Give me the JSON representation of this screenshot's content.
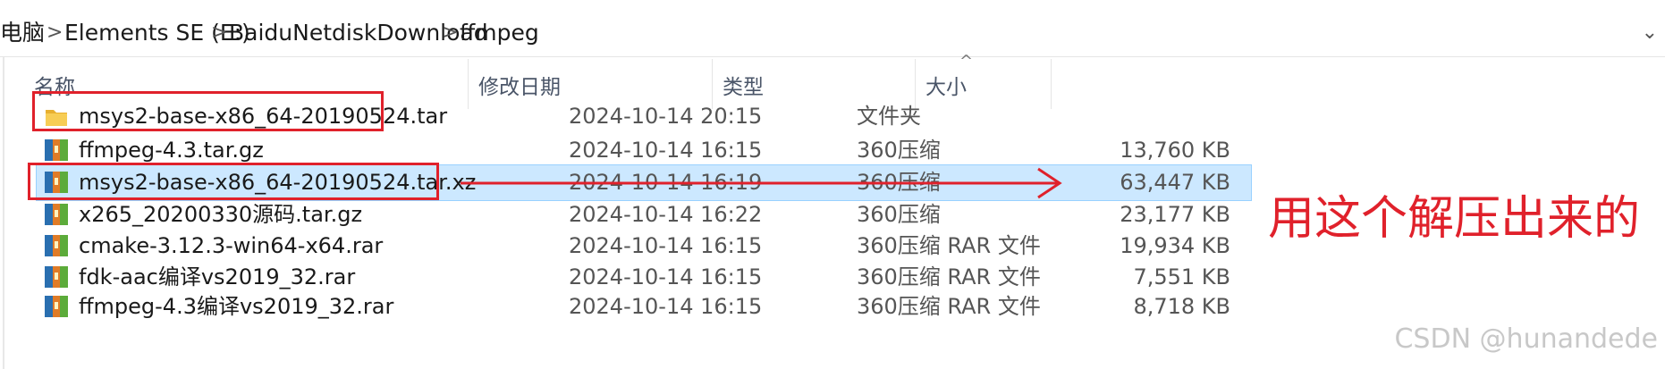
{
  "breadcrumb": {
    "items": [
      "电脑",
      "Elements SE (E:)",
      "BaiduNetdiskDownload",
      "ffmpeg"
    ],
    "separator": ">",
    "dropdown": "⌄"
  },
  "columns": {
    "name": "名称",
    "modified": "修改日期",
    "type": "类型",
    "size": "大小",
    "sort_indicator": "^"
  },
  "files": [
    {
      "name": "msys2-base-x86_64-20190524.tar",
      "modified": "2024-10-14 20:15",
      "type": "文件夹",
      "size": "",
      "icon": "folder-icon",
      "selected": false
    },
    {
      "name": "ffmpeg-4.3.tar.gz",
      "modified": "2024-10-14 16:15",
      "type": "360压缩",
      "size": "13,760 KB",
      "icon": "archive-icon",
      "selected": false
    },
    {
      "name": "msys2-base-x86_64-20190524.tar.xz",
      "modified": "2024-10-14 16:19",
      "type": "360压缩",
      "size": "63,447 KB",
      "icon": "archive-icon",
      "selected": true
    },
    {
      "name": "x265_20200330源码.tar.gz",
      "modified": "2024-10-14 16:22",
      "type": "360压缩",
      "size": "23,177 KB",
      "icon": "archive-icon",
      "selected": false
    },
    {
      "name": "cmake-3.12.3-win64-x64.rar",
      "modified": "2024-10-14 16:15",
      "type": "360压缩 RAR 文件",
      "size": "19,934 KB",
      "icon": "archive-icon",
      "selected": false
    },
    {
      "name": "fdk-aac编译vs2019_32.rar",
      "modified": "2024-10-14 16:15",
      "type": "360压缩 RAR 文件",
      "size": "7,551 KB",
      "icon": "archive-icon",
      "selected": false
    },
    {
      "name": "ffmpeg-4.3编译vs2019_32.rar",
      "modified": "2024-10-14 16:15",
      "type": "360压缩 RAR 文件",
      "size": "8,718 KB",
      "icon": "archive-icon",
      "selected": false
    }
  ],
  "annotation": {
    "text": "用这个解压出来的",
    "color": "#e0212b"
  },
  "watermark": "CSDN @hunandede",
  "colors": {
    "selection": "#cce8ff",
    "folder": "#f5c242",
    "annotation": "#e0212b"
  }
}
